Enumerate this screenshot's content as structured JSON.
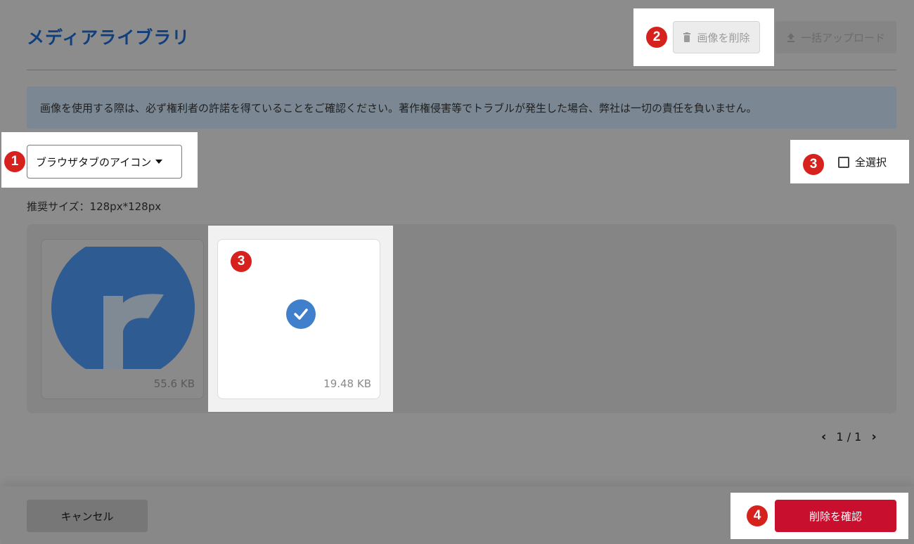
{
  "header": {
    "title": "メディアライブラリ",
    "delete_image_label": "画像を削除",
    "bulk_upload_label": "一括アップロード"
  },
  "notice": {
    "text": "画像を使用する際は、必ず権利者の許諾を得ていることをご確認ください。著作権侵害等でトラブルが発生した場合、弊社は一切の責任を負いません。"
  },
  "filter": {
    "category_selected": "ブラウザタブのアイコン",
    "select_all_label": "全選択",
    "recommended_size": "推奨サイズ：128px*128px"
  },
  "gallery": {
    "items": [
      {
        "size": "55.6 KB",
        "selected": false,
        "icon": "logo-r-icon"
      },
      {
        "size": "19.48 KB",
        "selected": true,
        "icon": "check-circle-icon"
      }
    ]
  },
  "pagination": {
    "label": "1 / 1"
  },
  "footer": {
    "cancel_label": "キャンセル",
    "confirm_delete_label": "削除を確認"
  },
  "annotations": {
    "badge_1": "1",
    "badge_2": "2",
    "badge_3a": "3",
    "badge_3b": "3",
    "badge_4": "4"
  },
  "colors": {
    "accent_red": "#c8102e",
    "title_blue": "#113f7e",
    "badge_red": "#d6211c",
    "check_blue": "#3f7fcc",
    "logo_blue": "#2f5b93"
  }
}
